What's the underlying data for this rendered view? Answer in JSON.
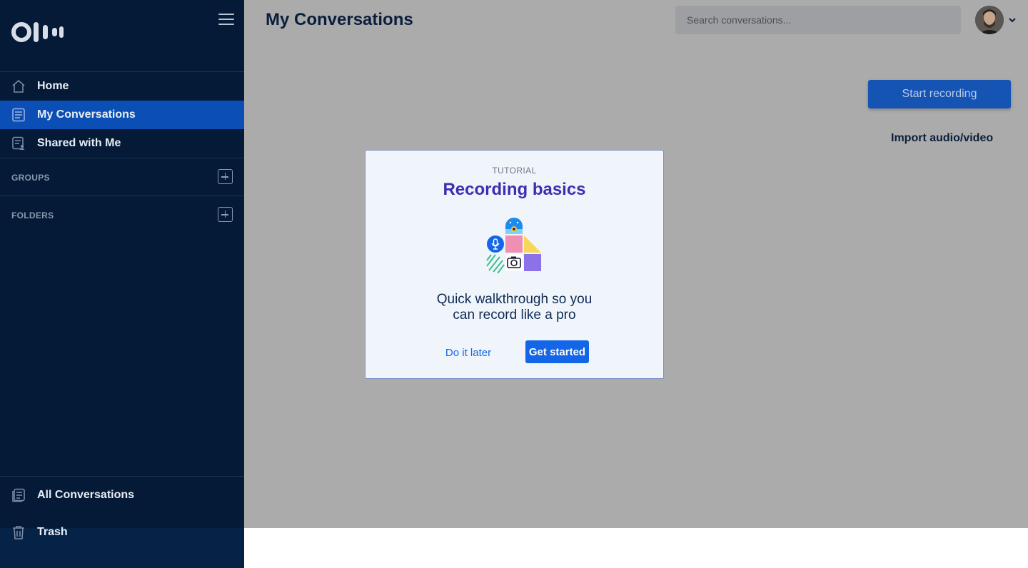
{
  "app": {
    "name": "Otter",
    "logo_icon": "otter-logo-icon"
  },
  "sidebar": {
    "menu_icon": "hamburger-icon",
    "items": [
      {
        "label": "Home",
        "icon": "home-icon"
      },
      {
        "label": "My Conversations",
        "icon": "document-icon",
        "active": true
      },
      {
        "label": "Shared with Me",
        "icon": "shared-document-icon"
      }
    ],
    "groups_label": "GROUPS",
    "folders_label": "FOLDERS",
    "bottom_items": [
      {
        "label": "All Conversations",
        "icon": "stacked-documents-icon"
      },
      {
        "label": "Trash",
        "icon": "trash-icon"
      }
    ]
  },
  "header": {
    "title": "My Conversations",
    "search_placeholder": "Search conversations..."
  },
  "actions": {
    "start_recording": "Start recording",
    "import": "Import audio/video"
  },
  "modal": {
    "eyebrow": "TUTORIAL",
    "title": "Recording basics",
    "body_line1": "Quick walkthrough so you",
    "body_line2": "can record like a pro",
    "secondary": "Do it later",
    "primary": "Get started"
  },
  "colors": {
    "sidebar_bg": "#041a36",
    "active_item": "#0b4fb6",
    "overlay": "#ababab",
    "modal_title": "#3a2fb0",
    "primary_button": "#1466e8"
  }
}
